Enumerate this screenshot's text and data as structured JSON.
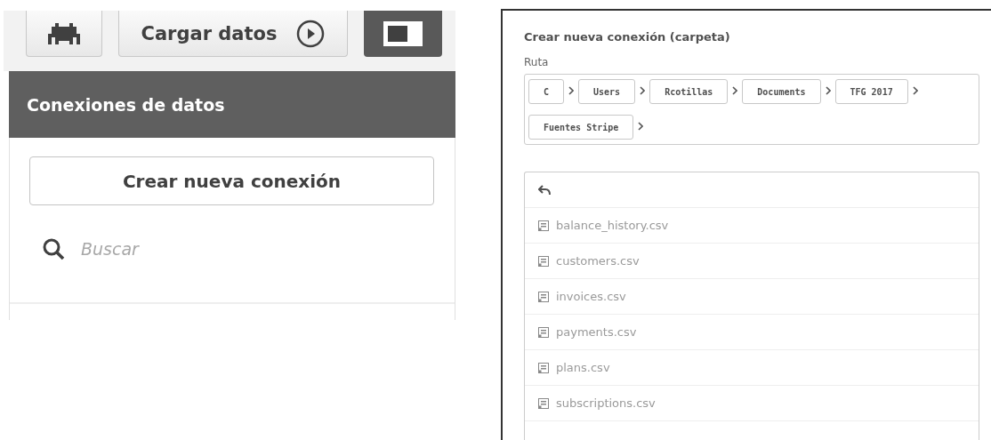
{
  "toolbar": {
    "load_button": "Cargar datos"
  },
  "panel": {
    "title": "Conexiones de datos",
    "create_button": "Crear nueva conexión",
    "search": {
      "placeholder": "Buscar"
    }
  },
  "dialog": {
    "title": "Crear nueva conexión (carpeta)",
    "path_label": "Ruta",
    "path": [
      "C",
      "Users",
      "Rcotillas",
      "Documents",
      "TFG 2017",
      "Fuentes Stripe"
    ],
    "files": [
      "balance_history.csv",
      "customers.csv",
      "invoices.csv",
      "payments.csv",
      "plans.csv",
      "subscriptions.csv"
    ]
  }
}
